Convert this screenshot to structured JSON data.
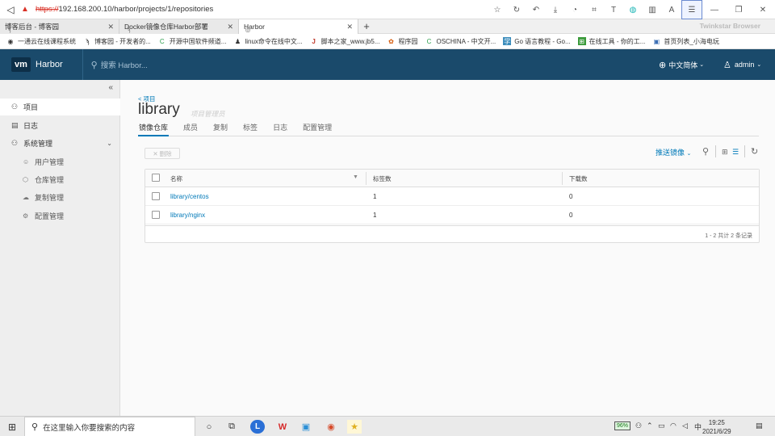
{
  "browser": {
    "url_proto": "https://",
    "url_rest": "192.168.200.10/harbor/projects/1/repositories",
    "brand_name": "Twinkstar Browser",
    "tabs": [
      {
        "label": "博客后台 - 博客园",
        "active": false
      },
      {
        "label": "Docker镜像仓库Harbor部署",
        "active": false
      },
      {
        "label": "Harbor",
        "active": true
      }
    ],
    "bookmarks": [
      "一通云在线课程系统",
      "博客园 - 开发者的...",
      "开源中国软件频道...",
      "linux命令在线中文...",
      "脚本之家_www.jb5...",
      "程序园",
      "OSCHINA - 中文开...",
      "Go 语言教程 - Go...",
      "在线工具 - 你的工...",
      "首页列表_小海电玩"
    ]
  },
  "header": {
    "logo": "vm",
    "app_name": "Harbor",
    "search_placeholder": "搜索 Harbor...",
    "language": "中文简体",
    "user": "admin"
  },
  "sidebar": {
    "collapse_icon": "«",
    "items": [
      {
        "label": "项目",
        "icon": "project-icon",
        "active": true
      },
      {
        "label": "日志",
        "icon": "log-icon",
        "active": false
      },
      {
        "label": "系统管理",
        "icon": "admin-icon",
        "active": false,
        "expanded": true
      }
    ],
    "sub_items": [
      {
        "label": "用户管理",
        "icon": "users-icon"
      },
      {
        "label": "仓库管理",
        "icon": "registry-icon"
      },
      {
        "label": "复制管理",
        "icon": "replication-icon"
      },
      {
        "label": "配置管理",
        "icon": "settings-icon"
      }
    ]
  },
  "main": {
    "breadcrumb": "< 项目",
    "title": "library",
    "role": "项目管理员",
    "tabs": [
      {
        "label": "镜像仓库",
        "active": true
      },
      {
        "label": "成员",
        "active": false
      },
      {
        "label": "复制",
        "active": false
      },
      {
        "label": "标签",
        "active": false
      },
      {
        "label": "日志",
        "active": false
      },
      {
        "label": "配置管理",
        "active": false
      }
    ],
    "delete_label": "✕ 删除",
    "push_label": "推送镜像",
    "table": {
      "columns": [
        "名称",
        "标签数",
        "下载数"
      ],
      "rows": [
        {
          "name": "library/centos",
          "tags": "1",
          "pulls": "0"
        },
        {
          "name": "library/nginx",
          "tags": "1",
          "pulls": "0"
        }
      ],
      "footer": "1 - 2 共计 2 条记录"
    }
  },
  "taskbar": {
    "search_placeholder": "在这里输入你要搜索的内容",
    "battery": "96%",
    "ime": "中",
    "time": "19:25",
    "date": "2021/6/29"
  }
}
